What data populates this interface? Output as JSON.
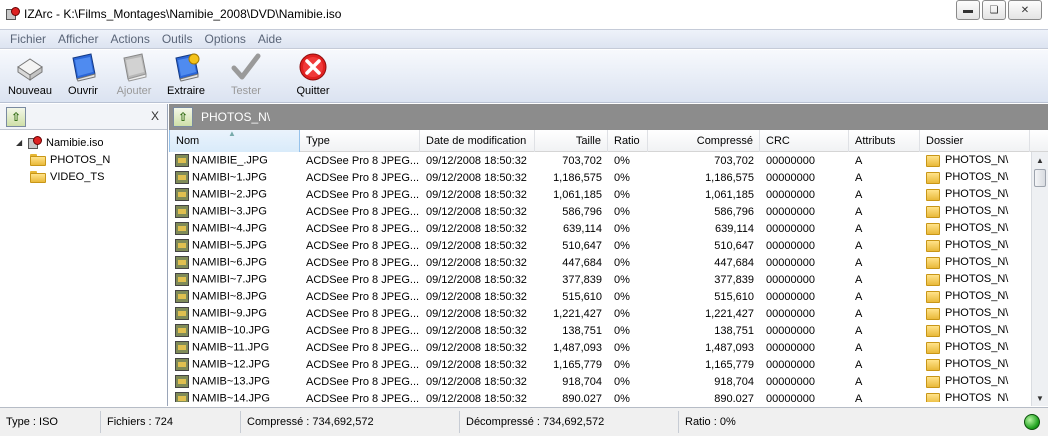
{
  "window": {
    "title": "IZArc - K:\\Films_Montages\\Namibie_2008\\DVD\\Namibie.iso",
    "min_label": "▭",
    "max_label": "◻",
    "close_label": "✕"
  },
  "menu": [
    "Fichier",
    "Afficher",
    "Actions",
    "Outils",
    "Options",
    "Aide"
  ],
  "toolbar": {
    "buttons": [
      {
        "label": "Nouveau",
        "icon": "new-archive-icon",
        "enabled": true
      },
      {
        "label": "Ouvrir",
        "icon": "open-book-icon",
        "enabled": true
      },
      {
        "label": "Ajouter",
        "icon": "add-file-icon",
        "enabled": false
      },
      {
        "label": "Extraire",
        "icon": "extract-icon",
        "enabled": true
      },
      {
        "label": "Tester",
        "icon": "check-icon",
        "enabled": false
      },
      {
        "label": "Quitter",
        "icon": "quit-icon",
        "enabled": true
      }
    ]
  },
  "tree": {
    "close_label": "X",
    "root": "Namibie.iso",
    "children": [
      "PHOTOS_N",
      "VIDEO_TS"
    ]
  },
  "path": "PHOTOS_N\\",
  "columns": [
    "Nom",
    "Type",
    "Date de modification",
    "Taille",
    "Ratio",
    "Compressé",
    "CRC",
    "Attributs",
    "Dossier"
  ],
  "rows": [
    [
      "NAMIBIE_.JPG",
      "ACDSee Pro 8 JPEG...",
      "09/12/2008 18:50:32",
      "703,702",
      "0%",
      "703,702",
      "00000000",
      "A",
      "PHOTOS_N\\"
    ],
    [
      "NAMIBI~1.JPG",
      "ACDSee Pro 8 JPEG...",
      "09/12/2008 18:50:32",
      "1,186,575",
      "0%",
      "1,186,575",
      "00000000",
      "A",
      "PHOTOS_N\\"
    ],
    [
      "NAMIBI~2.JPG",
      "ACDSee Pro 8 JPEG...",
      "09/12/2008 18:50:32",
      "1,061,185",
      "0%",
      "1,061,185",
      "00000000",
      "A",
      "PHOTOS_N\\"
    ],
    [
      "NAMIBI~3.JPG",
      "ACDSee Pro 8 JPEG...",
      "09/12/2008 18:50:32",
      "586,796",
      "0%",
      "586,796",
      "00000000",
      "A",
      "PHOTOS_N\\"
    ],
    [
      "NAMIBI~4.JPG",
      "ACDSee Pro 8 JPEG...",
      "09/12/2008 18:50:32",
      "639,114",
      "0%",
      "639,114",
      "00000000",
      "A",
      "PHOTOS_N\\"
    ],
    [
      "NAMIBI~5.JPG",
      "ACDSee Pro 8 JPEG...",
      "09/12/2008 18:50:32",
      "510,647",
      "0%",
      "510,647",
      "00000000",
      "A",
      "PHOTOS_N\\"
    ],
    [
      "NAMIBI~6.JPG",
      "ACDSee Pro 8 JPEG...",
      "09/12/2008 18:50:32",
      "447,684",
      "0%",
      "447,684",
      "00000000",
      "A",
      "PHOTOS_N\\"
    ],
    [
      "NAMIBI~7.JPG",
      "ACDSee Pro 8 JPEG...",
      "09/12/2008 18:50:32",
      "377,839",
      "0%",
      "377,839",
      "00000000",
      "A",
      "PHOTOS_N\\"
    ],
    [
      "NAMIBI~8.JPG",
      "ACDSee Pro 8 JPEG...",
      "09/12/2008 18:50:32",
      "515,610",
      "0%",
      "515,610",
      "00000000",
      "A",
      "PHOTOS_N\\"
    ],
    [
      "NAMIBI~9.JPG",
      "ACDSee Pro 8 JPEG...",
      "09/12/2008 18:50:32",
      "1,221,427",
      "0%",
      "1,221,427",
      "00000000",
      "A",
      "PHOTOS_N\\"
    ],
    [
      "NAMIB~10.JPG",
      "ACDSee Pro 8 JPEG...",
      "09/12/2008 18:50:32",
      "138,751",
      "0%",
      "138,751",
      "00000000",
      "A",
      "PHOTOS_N\\"
    ],
    [
      "NAMIB~11.JPG",
      "ACDSee Pro 8 JPEG...",
      "09/12/2008 18:50:32",
      "1,487,093",
      "0%",
      "1,487,093",
      "00000000",
      "A",
      "PHOTOS_N\\"
    ],
    [
      "NAMIB~12.JPG",
      "ACDSee Pro 8 JPEG...",
      "09/12/2008 18:50:32",
      "1,165,779",
      "0%",
      "1,165,779",
      "00000000",
      "A",
      "PHOTOS_N\\"
    ],
    [
      "NAMIB~13.JPG",
      "ACDSee Pro 8 JPEG...",
      "09/12/2008 18:50:32",
      "918,704",
      "0%",
      "918,704",
      "00000000",
      "A",
      "PHOTOS_N\\"
    ],
    [
      "NAMIB~14.JPG",
      "ACDSee Pro 8 JPEG...",
      "09/12/2008 18:50:32",
      "890,027",
      "0%",
      "890,027",
      "00000000",
      "A",
      "PHOTOS_N\\"
    ]
  ],
  "status": {
    "type": "Type : ISO",
    "files": "Fichiers : 724",
    "compressed": "Compressé : 734,692,572",
    "decompressed": "Décompressé : 734,692,572",
    "ratio": "Ratio : 0%"
  }
}
